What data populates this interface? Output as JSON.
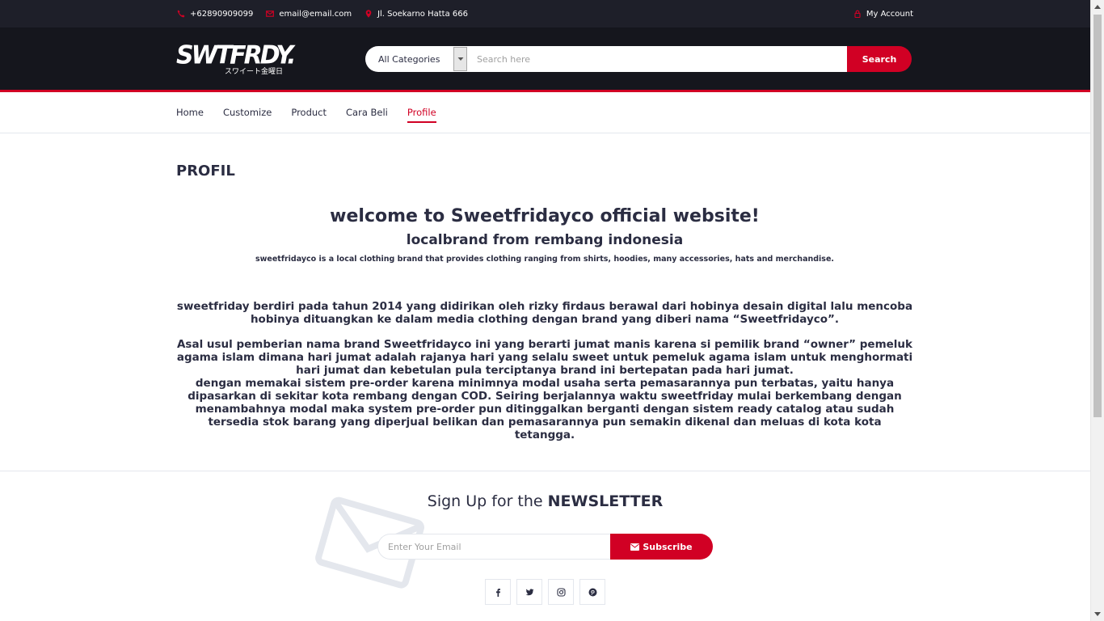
{
  "topbar": {
    "phone": "+62890909099",
    "email": "email@email.com",
    "address": "Jl. Soekarno Hatta 666",
    "account": "My Account"
  },
  "header": {
    "logo_main": "SWTFRDY.",
    "logo_sub": "スワイート金曜日",
    "category_selected": "All Categories",
    "search_placeholder": "Search here",
    "search_button": "Search"
  },
  "nav": {
    "items": [
      {
        "label": "Home"
      },
      {
        "label": "Customize"
      },
      {
        "label": "Product"
      },
      {
        "label": "Cara Beli"
      },
      {
        "label": "Profile"
      }
    ]
  },
  "content": {
    "title": "PROFIL",
    "welcome": "welcome to Sweetfridayco official website!",
    "tagline": "localbrand from rembang indonesia",
    "description": "sweetfridayco is a local clothing brand that provides clothing ranging from shirts, hoodies, many accessories, hats and merchandise.",
    "paragraph1": "sweetfriday berdiri pada tahun 2014 yang didirikan oleh rizky firdaus berawal dari hobinya desain digital lalu mencoba hobinya dituangkan ke dalam media clothing dengan brand yang diberi nama “Sweetfridayco”.",
    "paragraph2": "Asal usul pemberian nama brand Sweetfridayco ini yang berarti jumat manis karena si pemilik brand “owner” pemeluk agama islam dimana hari jumat adalah rajanya hari yang selalu sweet untuk pemeluk agama islam untuk menghormati hari jumat dan kebetulan pula terciptanya brand ini bertepatan pada hari jumat.",
    "paragraph3": "dengan memakai sistem pre-order karena minimnya modal usaha serta pemasarannya pun terbatas, yaitu hanya dipasarkan di sekitar kota rembang dengan COD. Seiring berjalannya waktu sweetfriday mulai berkembang dengan menambahnya modal maka system pre-order pun ditinggalkan berganti dengan sistem ready catalog atau sudah tersedia stok barang yang diperjual belikan dan pemasarannya pun semakin dikenal dan meluas di kota kota tetangga."
  },
  "newsletter": {
    "title_prefix": "Sign Up for the",
    "title_bold": "NEWSLETTER",
    "email_placeholder": "Enter Your Email",
    "subscribe": "Subscribe"
  },
  "colors": {
    "accent": "#d10024",
    "dark_header": "#15161d",
    "topbar": "#1e1f29",
    "text": "#2b2d42"
  },
  "icons": [
    "phone-icon",
    "envelope-icon",
    "map-marker-icon",
    "user-icon",
    "facebook-icon",
    "twitter-icon",
    "instagram-icon",
    "pinterest-icon"
  ]
}
